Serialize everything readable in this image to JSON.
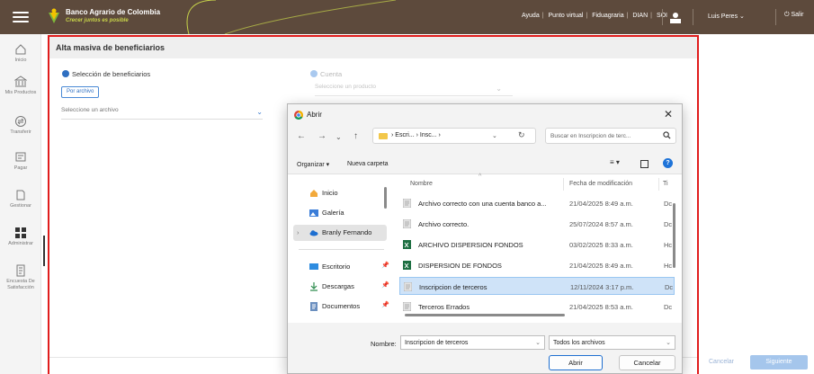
{
  "topbar": {
    "brand": "Banco Agrario de Colombia",
    "tagline": "Crecer juntos es posible",
    "links": [
      "Ayuda",
      "Punto virtual",
      "Fiduagraria",
      "DIAN",
      "SOI"
    ],
    "user": "Luis Peres",
    "logout": "Salir"
  },
  "sidebar": {
    "items": [
      {
        "label": "Inicio",
        "icon": "home-icon"
      },
      {
        "label": "Mis Productos",
        "icon": "bank-icon"
      },
      {
        "label": "Transferir",
        "icon": "transfer-icon"
      },
      {
        "label": "Pagar",
        "icon": "payment-icon"
      },
      {
        "label": "Gestionar",
        "icon": "manage-icon"
      },
      {
        "label": "Administrar",
        "icon": "admin-grid-icon"
      },
      {
        "label": "Encuesta De Satisfacción",
        "icon": "survey-icon"
      }
    ]
  },
  "page": {
    "title": "Alta masiva de beneficiarios",
    "step1_label": "Selección de beneficiarios",
    "file_button": "Por archivo",
    "file_select": "Seleccione un archivo",
    "step2_label": "Cuenta",
    "product_select": "Seleccione un producto",
    "cancel": "Cancelar",
    "next": "Siguiente",
    "colors": {
      "brand_bar": "#5d4a3c",
      "accent": "#2f6fc1",
      "highlight_border": "#e01c1c"
    }
  },
  "dialog": {
    "title": "Abrir",
    "breadcrumb": "› Escri... › Insc... ›",
    "search_placeholder": "Buscar en Inscripcion de terc...",
    "organize": "Organizar ▾",
    "new_folder": "Nueva carpeta",
    "nav": [
      "Inicio",
      "Galería",
      "Branly Fernando",
      "Escritorio",
      "Descargas",
      "Documentos"
    ],
    "columns": {
      "name": "Nombre",
      "date": "Fecha de modificación",
      "type": "Ti"
    },
    "files": [
      {
        "name": "Archivo correcto con una cuenta banco a...",
        "date": "21/04/2025 8:49 a.m.",
        "type": "Dc"
      },
      {
        "name": "Archivo correcto.",
        "date": "25/07/2024 8:57 a.m.",
        "type": "Dc"
      },
      {
        "name": "ARCHIVO DISPERSION FONDOS",
        "date": "03/02/2025 8:33 a.m.",
        "type": "Hc"
      },
      {
        "name": "DISPERSION DE FONDOS",
        "date": "21/04/2025 8:49 a.m.",
        "type": "Hc"
      },
      {
        "name": "Inscripcion de terceros",
        "date": "12/11/2024 3:17 p.m.",
        "type": "Dc"
      },
      {
        "name": "Terceros Errados",
        "date": "21/04/2025 8:53 a.m.",
        "type": "Dc"
      }
    ],
    "filename_label": "Nombre:",
    "filename_value": "Inscripcion de terceros",
    "filetype_value": "Todos los archivos",
    "open_button": "Abrir",
    "cancel_button": "Cancelar"
  }
}
